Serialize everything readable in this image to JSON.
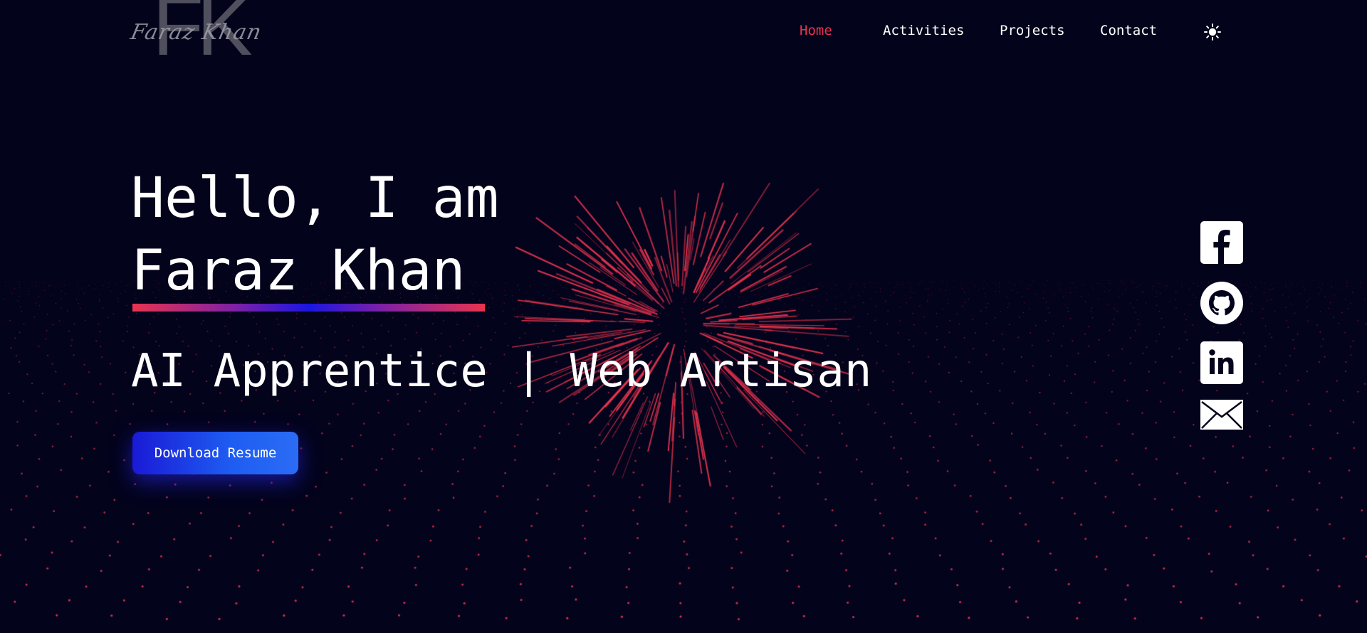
{
  "logo": {
    "monogram": "FK",
    "script": "Faraz Khan"
  },
  "nav": {
    "items": [
      {
        "label": "Home",
        "active": true
      },
      {
        "label": "Activities",
        "active": false
      },
      {
        "label": "Projects",
        "active": false
      },
      {
        "label": "Contact",
        "active": false
      }
    ],
    "theme_toggle_icon": "sun-icon"
  },
  "hero": {
    "greeting": "Hello, I am",
    "name": "Faraz Khan",
    "roles": "AI Apprentice | Web Artisan",
    "resume_button": "Download Resume"
  },
  "socials": [
    {
      "icon": "facebook-icon"
    },
    {
      "icon": "github-icon"
    },
    {
      "icon": "linkedin-icon"
    },
    {
      "icon": "mail-icon"
    }
  ],
  "colors": {
    "background": "#03031c",
    "accent": "#e8344e",
    "button_blue": "#1e5df2",
    "text": "#ffffff"
  }
}
